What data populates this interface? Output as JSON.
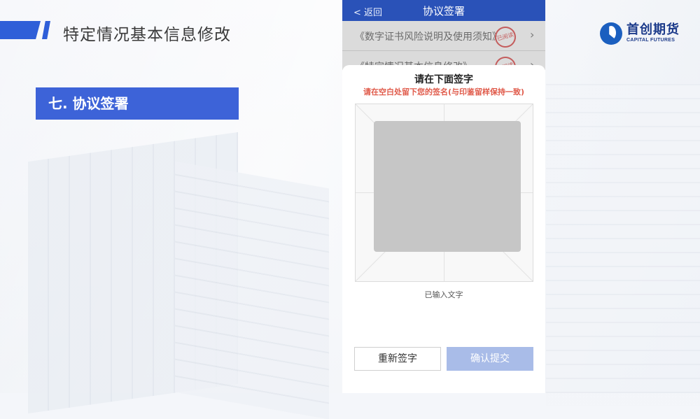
{
  "page": {
    "title": "特定情况基本信息修改",
    "section_label": "七. 协议签署"
  },
  "logo": {
    "name_cn": "首创期货",
    "name_en": "CAPITAL FUTURES"
  },
  "phone": {
    "nav": {
      "back_label": "< 返回",
      "title": "协议签署"
    },
    "documents": [
      {
        "label": "《数字证书风险说明及使用须知》",
        "stamp": "已阅读"
      },
      {
        "label": "《特定情况基本信息修改》",
        "stamp": "已阅读"
      }
    ],
    "signature_sheet": {
      "title": "请在下面签字",
      "hint": "请在空白处留下您的签名(与印鉴留样保持一致)",
      "typed_label": "已输入文字",
      "redo_button": "重新签字",
      "submit_button": "确认提交"
    }
  },
  "colors": {
    "accent": "#2f5fd8",
    "nav": "#2a52b8",
    "hint": "#e05a4a",
    "submit_disabled": "#a9bce8"
  }
}
